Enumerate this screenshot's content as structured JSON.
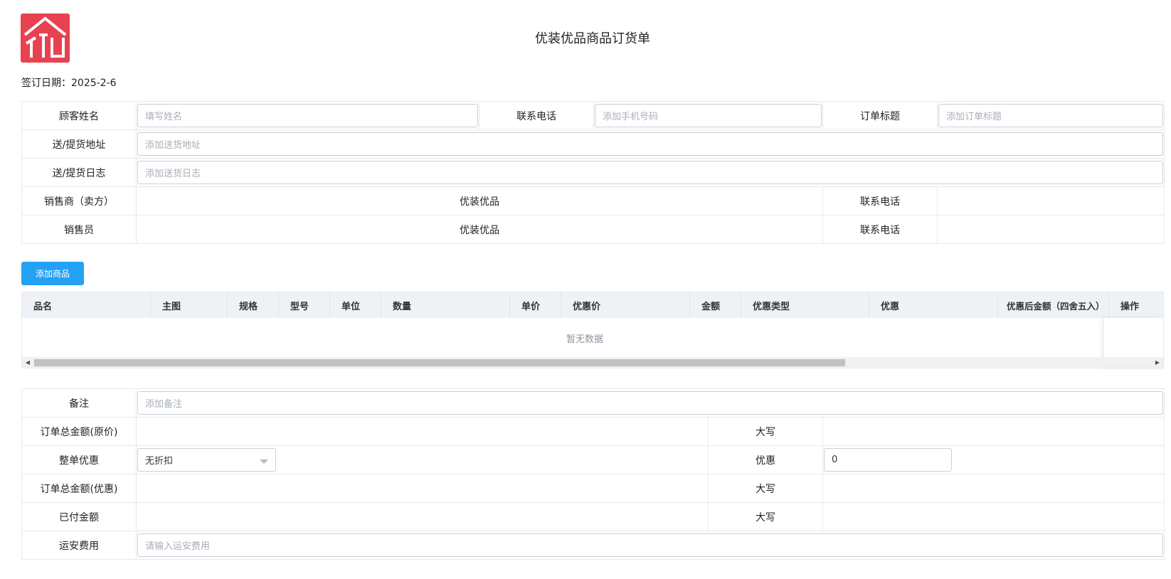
{
  "header": {
    "title": "优装优品商品订货单",
    "sign_date_label": "签订日期：",
    "sign_date_value": "2025-2-6",
    "logo_icon": "house-logo-icon",
    "brand_color": "#e84250"
  },
  "customer": {
    "name_label": "顾客姓名",
    "name_placeholder": "填写姓名",
    "phone_label": "联系电话",
    "phone_placeholder": "添加手机号码",
    "order_title_label": "订单标题",
    "order_title_placeholder": "添加订单标题",
    "address_label": "送/提货地址",
    "address_placeholder": "添加送货地址",
    "log_label": "送/提货日志",
    "log_placeholder": "添加送货日志",
    "seller_label": "销售商（卖方）",
    "seller_value": "优装优品",
    "seller_phone_label": "联系电话",
    "seller_phone_value": "",
    "salesman_label": "销售员",
    "salesman_value": "优装优品",
    "salesman_phone_label": "联系电话",
    "salesman_phone_value": ""
  },
  "goods": {
    "add_button": "添加商品",
    "accent_color": "#23a1f5",
    "columns": [
      "品名",
      "主图",
      "规格",
      "型号",
      "单位",
      "数量",
      "单价",
      "优惠价",
      "金额",
      "优惠类型",
      "优惠",
      "优惠后金额（四舍五入）",
      "操作"
    ],
    "empty_text": "暂无数据"
  },
  "summary": {
    "remark_label": "备注",
    "remark_placeholder": "添加备注",
    "total_original_label": "订单总金额(原价)",
    "total_original_value": "",
    "upper_label_1": "大写",
    "upper_value_1": "",
    "discount_label": "整单优惠",
    "discount_selected": "无折扣",
    "discount_amount_label": "优惠",
    "discount_amount_value": "0",
    "total_discount_label": "订单总金额(优惠)",
    "total_discount_value": "",
    "upper_label_2": "大写",
    "upper_value_2": "",
    "paid_label": "已付金额",
    "paid_value": "",
    "upper_label_3": "大写",
    "upper_value_3": "",
    "install_fee_label": "运安费用",
    "install_fee_placeholder": "请输入运安费用"
  }
}
